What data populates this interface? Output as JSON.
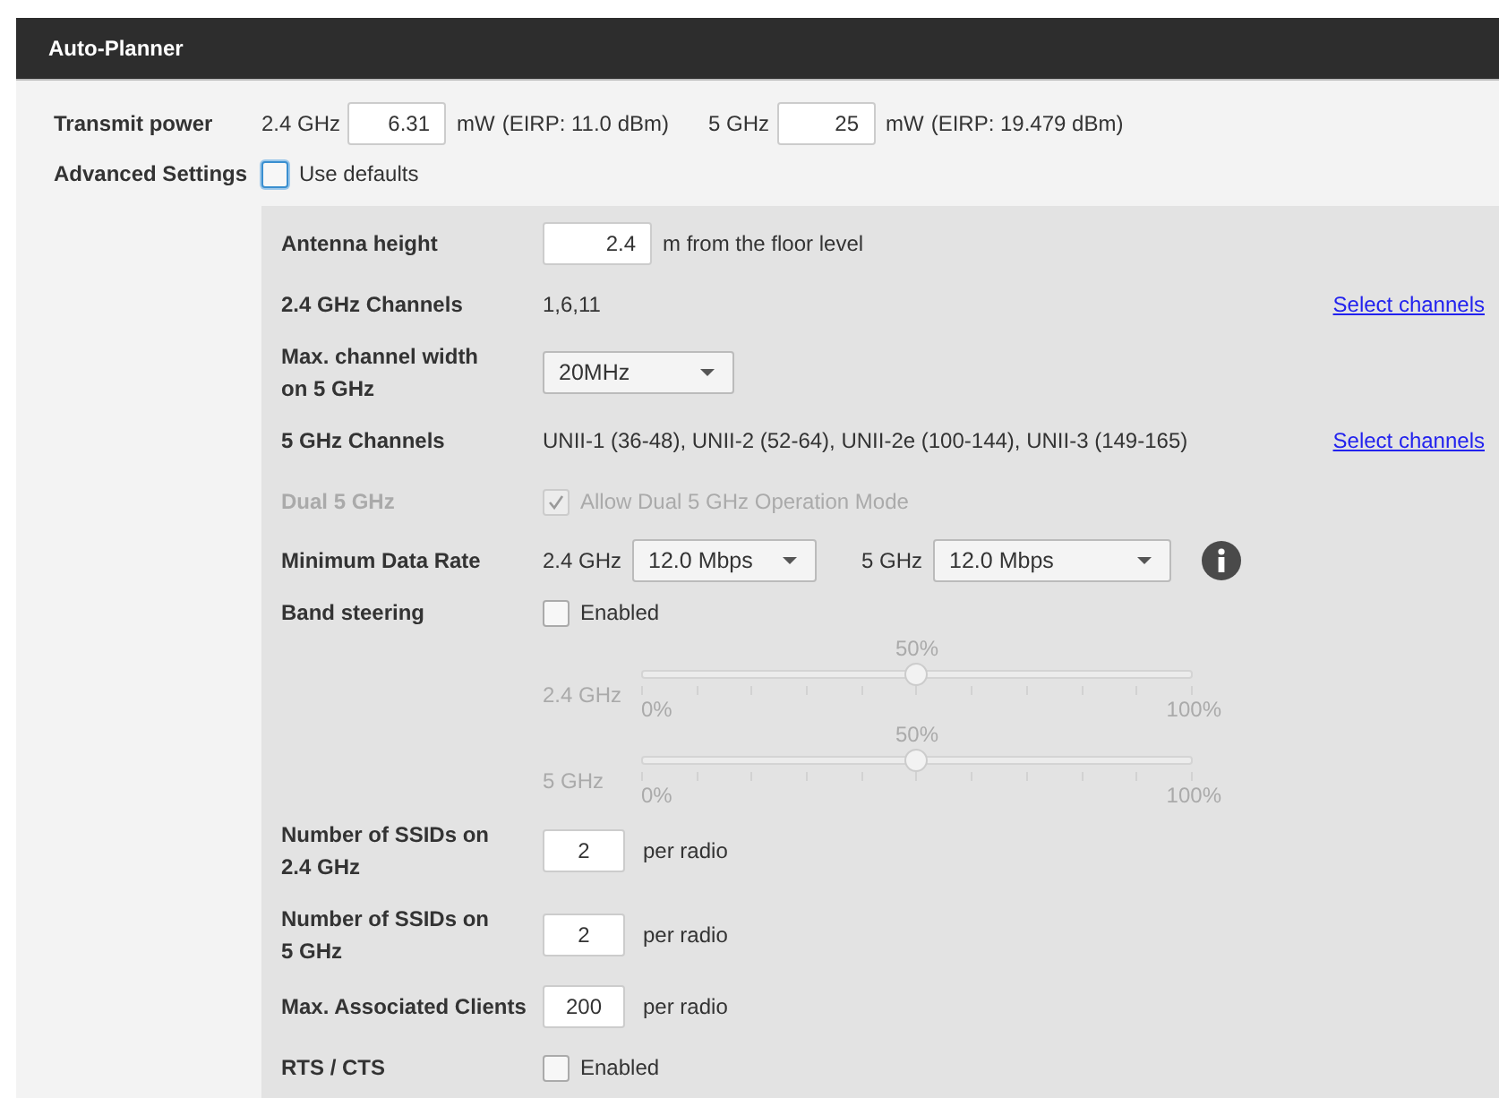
{
  "header": {
    "title": "Auto-Planner"
  },
  "transmit_power": {
    "label": "Transmit power",
    "bands": [
      {
        "band": "2.4 GHz",
        "value": "6.31",
        "unit": "mW",
        "eirp": "(EIRP: 11.0 dBm)"
      },
      {
        "band": "5 GHz",
        "value": "25",
        "unit": "mW",
        "eirp": "(EIRP: 19.479 dBm)"
      }
    ]
  },
  "advanced_settings": {
    "label": "Advanced Settings",
    "use_defaults": {
      "label": "Use defaults",
      "checked": false
    }
  },
  "rows": [
    {
      "kind": "input",
      "label": "Antenna height",
      "value": "2.4",
      "suffix": "m from the floor level"
    },
    {
      "kind": "text",
      "label": "2.4 GHz Channels",
      "value": "1,6,11",
      "link": "Select channels"
    },
    {
      "kind": "select",
      "label": "Max. channel width on 5 GHz",
      "value": "20MHz"
    },
    {
      "kind": "text",
      "label": "5 GHz Channels",
      "value": "UNII-1 (36-48), UNII-2 (52-64), UNII-2e (100-144), UNII-3 (149-165)",
      "link": "Select channels"
    },
    {
      "kind": "checkbox",
      "label": "Dual 5 GHz",
      "text": "Allow Dual 5 GHz Operation Mode",
      "checked": true,
      "disabled": true
    },
    {
      "kind": "rates",
      "label": "Minimum Data Rate",
      "items": [
        {
          "band": "2.4 GHz",
          "value": "12.0 Mbps"
        },
        {
          "band": "5 GHz",
          "value": "12.0 Mbps"
        }
      ]
    },
    {
      "kind": "checkbox",
      "label": "Band steering",
      "text": "Enabled",
      "checked": false,
      "disabled": false
    },
    {
      "kind": "slider",
      "band": "2.4 GHz",
      "level": 0.5,
      "reading": "50%",
      "min": "0%",
      "max": "100%"
    },
    {
      "kind": "slider",
      "band": "5 GHz",
      "level": 0.5,
      "reading": "50%",
      "min": "0%",
      "max": "100%"
    },
    {
      "kind": "count",
      "label": "Number of SSIDs on 2.4 GHz",
      "value": "2",
      "suffix": "per radio"
    },
    {
      "kind": "count",
      "label": "Number of SSIDs on 5 GHz",
      "value": "2",
      "suffix": "per radio"
    },
    {
      "kind": "count",
      "label": "Max. Associated Clients",
      "value": "200",
      "suffix": "per radio"
    },
    {
      "kind": "checkbox",
      "label": "RTS / CTS",
      "text": "Enabled",
      "checked": false,
      "disabled": false
    }
  ]
}
